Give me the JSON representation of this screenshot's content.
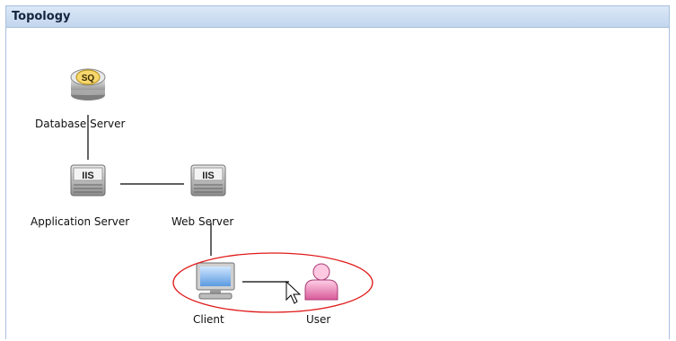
{
  "panel": {
    "title": "Topology"
  },
  "nodes": {
    "database_server": {
      "label": "Database Server",
      "icon": "sql-database-icon",
      "badge": "SQ"
    },
    "application_server": {
      "label": "Application Server",
      "icon": "iis-server-icon",
      "badge": "IIS"
    },
    "web_server": {
      "label": "Web Server",
      "icon": "iis-server-icon",
      "badge": "IIS"
    },
    "client": {
      "label": "Client",
      "icon": "monitor-icon"
    },
    "user": {
      "label": "User",
      "icon": "user-icon"
    }
  },
  "highlight": {
    "color": "#e01a1a"
  }
}
